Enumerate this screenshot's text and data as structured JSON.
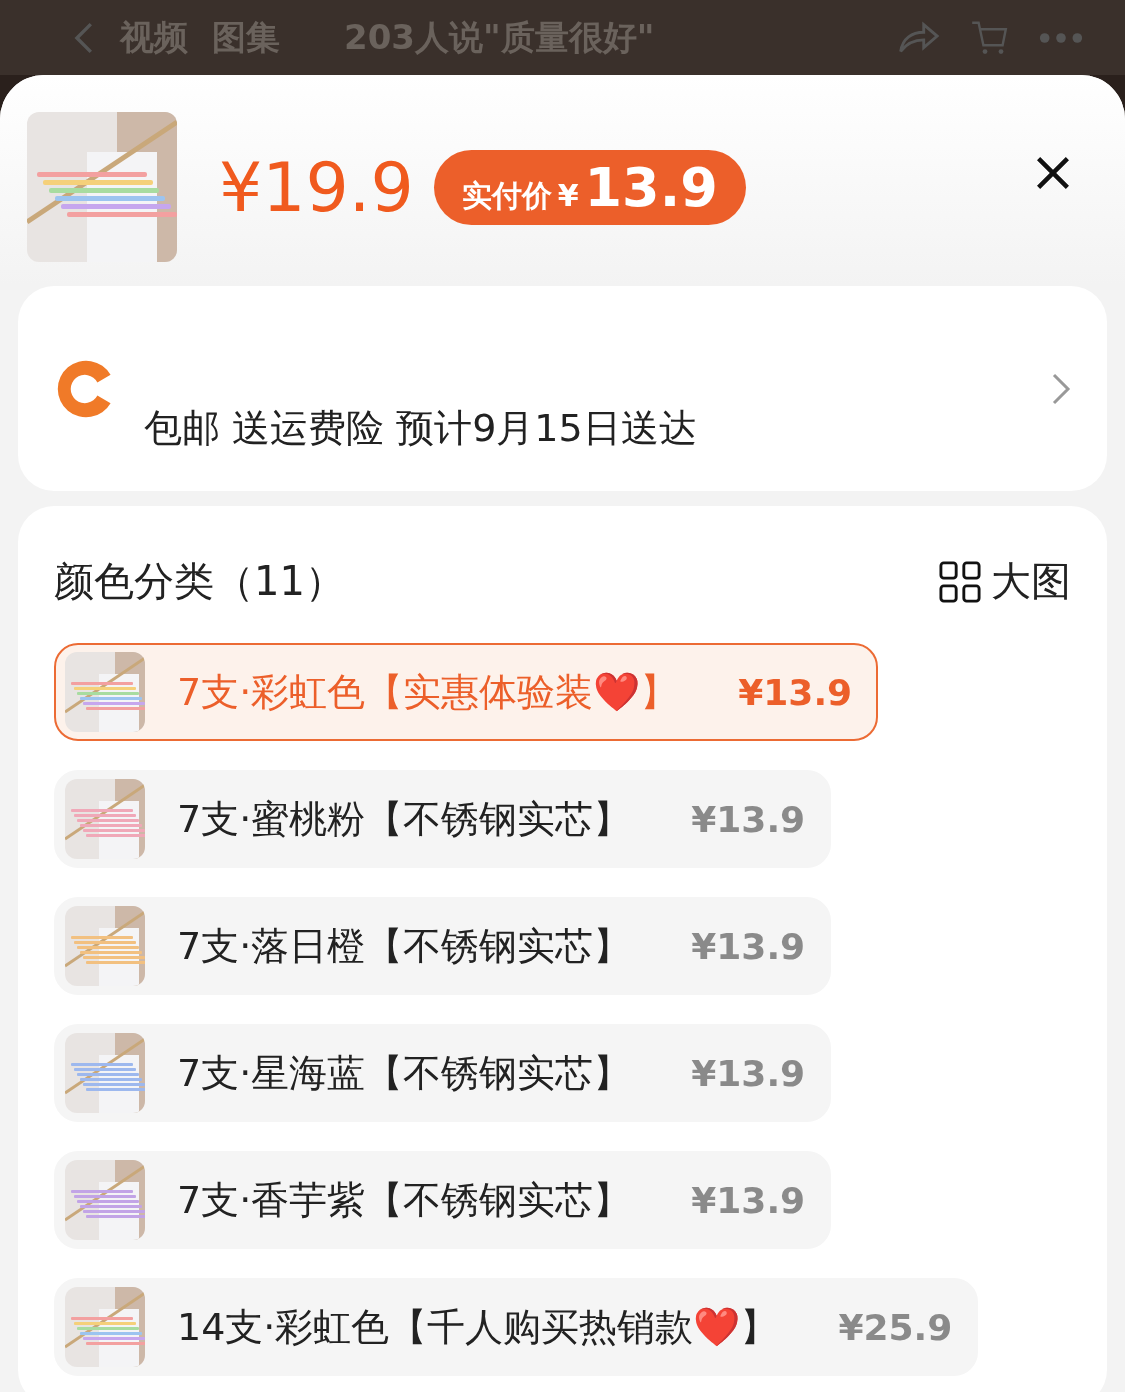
{
  "backdrop": {
    "tabs": [
      {
        "label": "视频",
        "selected": false
      },
      {
        "label": "图集",
        "selected": false
      }
    ],
    "review_bubble": "203人说\"质量很好\""
  },
  "header": {
    "original_price": "¥19.9",
    "paid_price_label": "实付价",
    "paid_price_currency": "¥",
    "paid_price": "13.9"
  },
  "shipping": {
    "info": "包邮 送运费险 预计9月15日送达"
  },
  "options": {
    "title": "颜色分类（11）",
    "large_view": "大图",
    "items": [
      {
        "label": "7支·彩虹色【实惠体验装❤️】",
        "price": "¥13.9",
        "selected": true
      },
      {
        "label": "7支·蜜桃粉【不锈钢实芯】",
        "price": "¥13.9",
        "selected": false
      },
      {
        "label": "7支·落日橙【不锈钢实芯】",
        "price": "¥13.9",
        "selected": false
      },
      {
        "label": "7支·星海蓝【不锈钢实芯】",
        "price": "¥13.9",
        "selected": false
      },
      {
        "label": "7支·香芋紫【不锈钢实芯】",
        "price": "¥13.9",
        "selected": false
      },
      {
        "label": "14支·彩虹色【千人购买热销款❤️】",
        "price": "¥25.9",
        "selected": false
      }
    ]
  }
}
